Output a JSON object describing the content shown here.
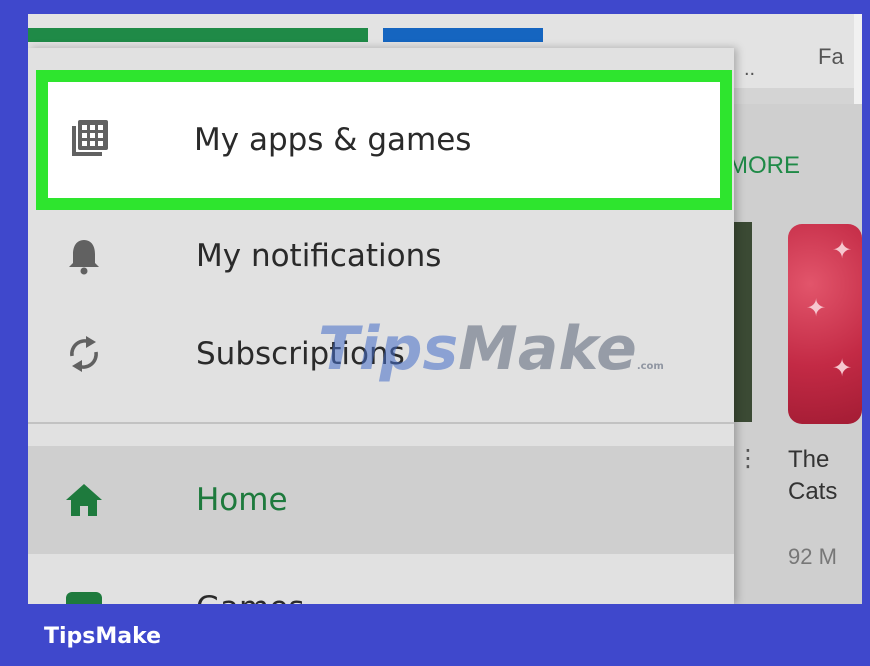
{
  "background_app": {
    "tab_fragment": "Fa",
    "tab_dots": "..",
    "more_link": "MORE",
    "card_title": "The Cats",
    "card_size": "92 M"
  },
  "drawer": {
    "items": [
      {
        "label": "My apps & games",
        "icon": "apps-grid-icon",
        "highlighted": true
      },
      {
        "label": "My notifications",
        "icon": "bell-icon"
      },
      {
        "label": "Subscriptions",
        "icon": "refresh-icon"
      },
      {
        "label": "Home",
        "icon": "home-icon",
        "selected": true
      },
      {
        "label": "Games",
        "icon": "gamepad-icon"
      }
    ]
  },
  "watermark": {
    "tips": "Tips",
    "make": "Make",
    "suffix": ".com"
  },
  "brand": {
    "text": "TipsMake"
  },
  "colors": {
    "highlight_border": "#2ee52e",
    "accent_green": "#1e7a3d",
    "frame_blue": "#3f48cc"
  }
}
